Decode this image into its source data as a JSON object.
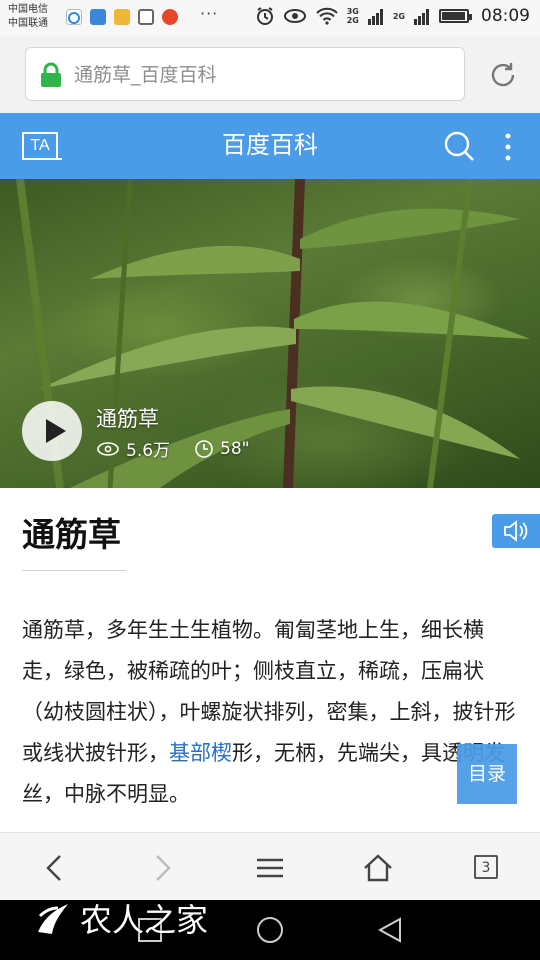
{
  "status_bar": {
    "carrier_1": "中国电信",
    "carrier_2": "中国联通",
    "more": "···",
    "net_tag_1": "3G",
    "net_tag_2": "2G",
    "net_tag_3": "2G",
    "time": "08:09",
    "battery_level": 0.95,
    "app_icons": [
      "qq-icon",
      "weather-icon",
      "notes-icon",
      "gallery-icon",
      "weibo-icon"
    ]
  },
  "address_bar": {
    "url_text": "通筋草_百度百科",
    "secure_color": "#2fb54a"
  },
  "header": {
    "logo_text": "TA",
    "title": "百度百科"
  },
  "video": {
    "title": "通筋草",
    "views": "5.6万",
    "duration": "58\""
  },
  "article": {
    "title": "通筋草",
    "body_before_link": "通筋草，多年生土生植物。匍匐茎地上生，细长横走，绿色，被稀疏的叶；侧枝直立，稀疏，压扁状（幼枝圆柱状），叶螺旋状排列，密集，上斜，披针形或线状披针形，",
    "body_link": "基部楔",
    "body_after_link": "形，无柄，先端尖，具透明发丝，中脉不明显。",
    "toc_label": "目录"
  },
  "toolbar": {
    "tab_count": "3"
  },
  "watermark": {
    "text": "农人之家"
  },
  "colors": {
    "accent": "#4a9be8",
    "link": "#2a6fc0"
  }
}
